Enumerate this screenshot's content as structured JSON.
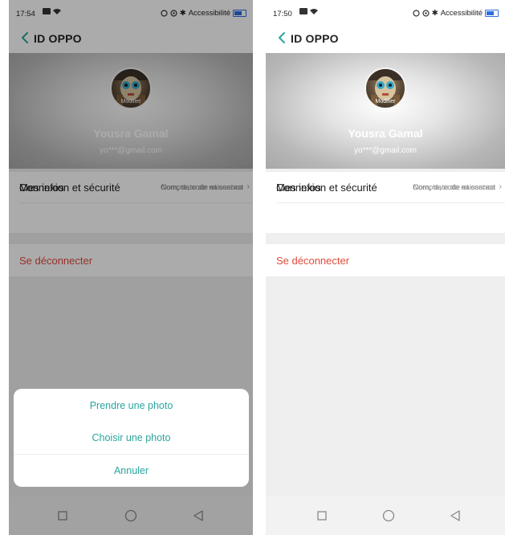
{
  "screens": {
    "left": {
      "status": {
        "time": "17:54",
        "accessibility": "Accessibilité"
      },
      "topbar": {
        "title": "ID OPPO"
      },
      "profile": {
        "avatar_label": "Modifier",
        "name": "Yousra Gamal",
        "email": "yo***@gmail.com"
      },
      "rows": [
        {
          "label": "Mes infos",
          "value": "Nom, date de naissance"
        },
        {
          "label": "Connexion et sécurité",
          "value": "Compte, code et contact"
        }
      ],
      "logout": "Se déconnecter",
      "sheet": {
        "take_photo": "Prendre une photo",
        "choose_photo": "Choisir une photo",
        "cancel": "Annuler"
      }
    },
    "right": {
      "status": {
        "time": "17:50",
        "accessibility": "Accessibilité"
      },
      "topbar": {
        "title": "ID OPPO"
      },
      "profile": {
        "avatar_label": "Modifier",
        "name": "Yousra Gamal",
        "email": "yo***@gmail.com"
      },
      "rows": [
        {
          "label": "Mes infos",
          "value": "Nom, date de naissance"
        },
        {
          "label": "Connexion et sécurité",
          "value": "Compte, code et contact"
        }
      ],
      "logout": "Se déconnecter"
    }
  },
  "colors": {
    "accent": "#2aa59e",
    "danger": "#e14b3c",
    "battery": "#2d6fe0"
  },
  "icons": [
    "back-chevron-icon",
    "square-icon",
    "circle-icon",
    "triangle-back-icon"
  ]
}
